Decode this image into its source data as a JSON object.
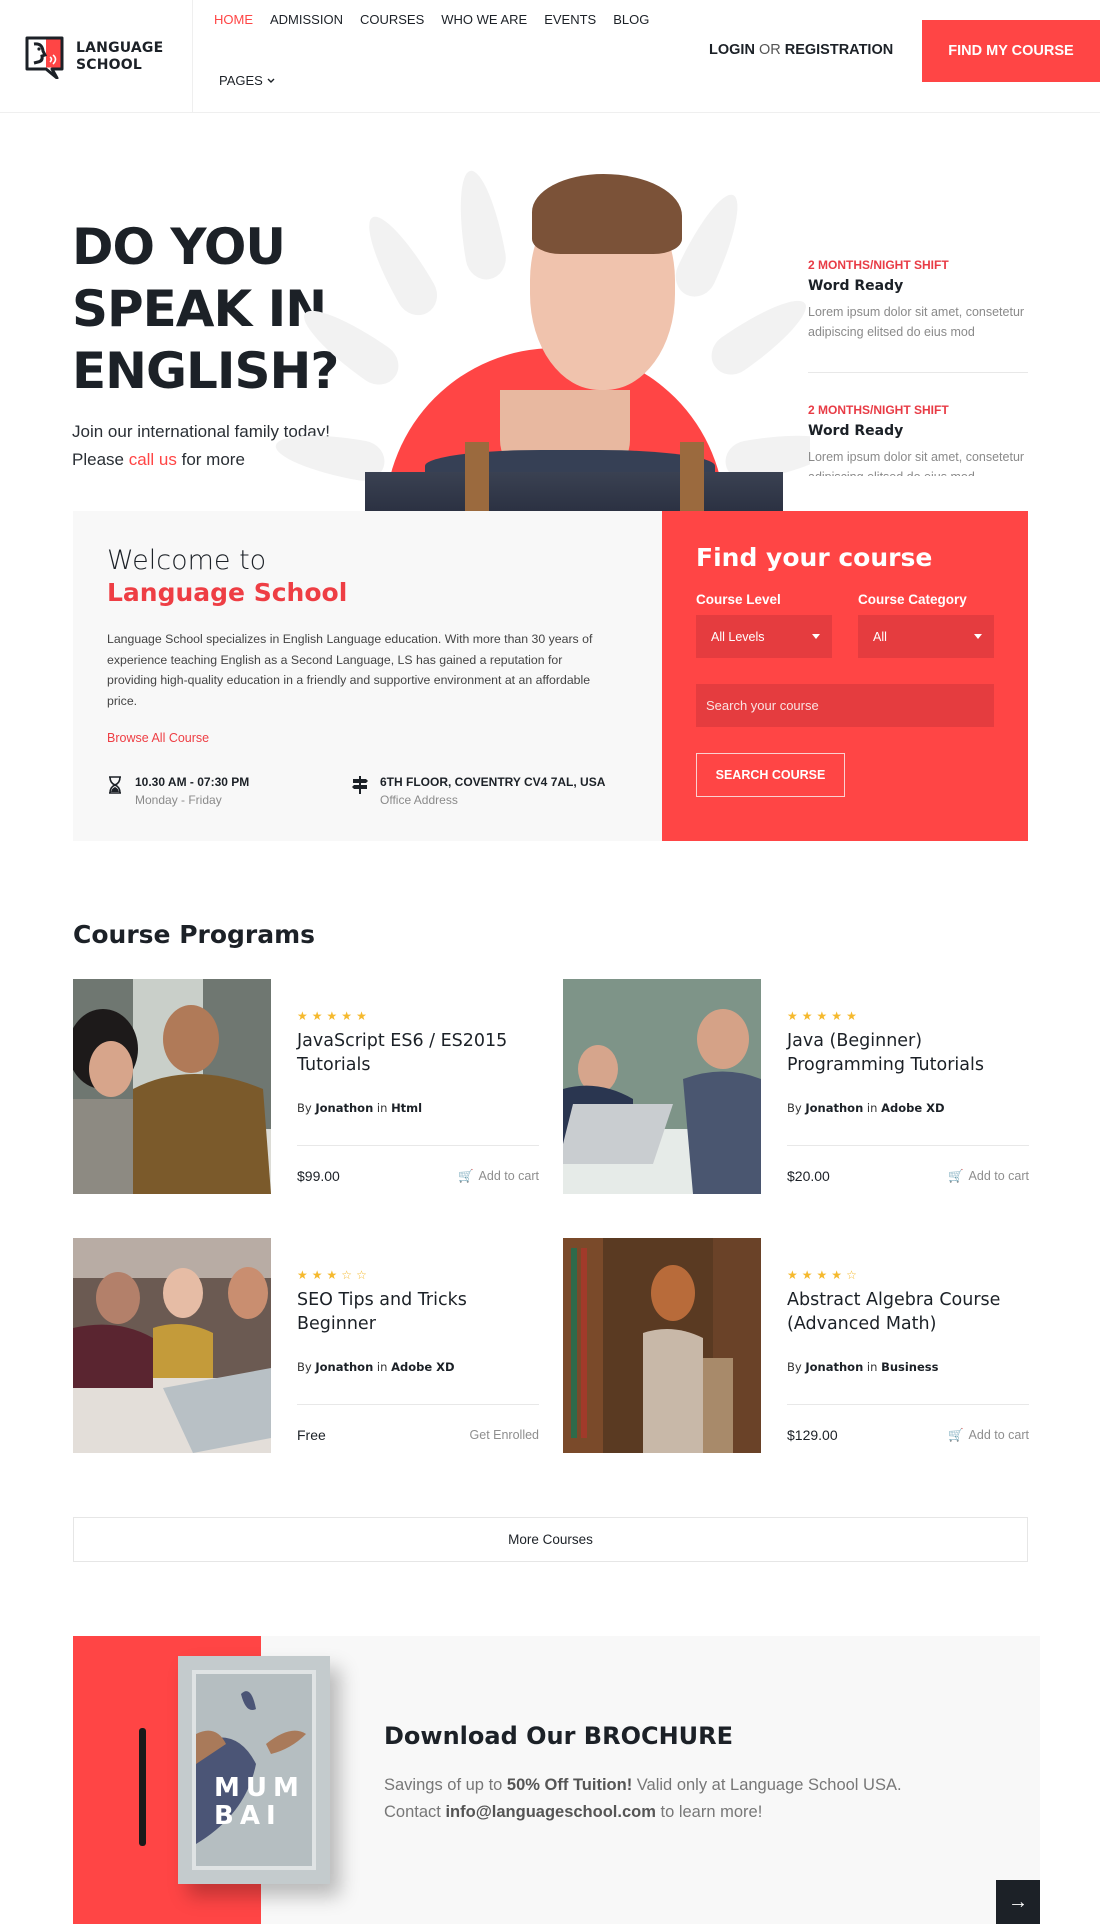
{
  "brand": {
    "line1": "LANGUAGE",
    "line2": "SCHOOL",
    "accent": "#ff4545"
  },
  "nav": {
    "items": [
      {
        "label": "HOME",
        "active": true
      },
      {
        "label": "ADMISSION"
      },
      {
        "label": "COURSES"
      },
      {
        "label": "WHO WE ARE"
      },
      {
        "label": "EVENTS"
      },
      {
        "label": "BLOG"
      }
    ],
    "pages": "PAGES",
    "login": "LOGIN",
    "or": "OR",
    "registration": "REGISTRATION",
    "cta": "FIND MY COURSE"
  },
  "hero": {
    "title_l1": "DO YOU",
    "title_l2": "SPEAK IN",
    "title_l3": "ENGLISH?",
    "sub_before": "Join our international family today! Please ",
    "sub_link": "call us",
    "sub_after": " for more",
    "shifts": [
      {
        "tag": "2 MONTHS/NIGHT SHIFT",
        "title": "Word Ready",
        "text": "Lorem ipsum dolor sit amet, consetetur adipiscing elitsed do eius mod"
      },
      {
        "tag": "2 MONTHS/NIGHT SHIFT",
        "title": "Word Ready",
        "text": "Lorem ipsum dolor sit amet, consetetur adipiscing elitsed do eius mod"
      }
    ]
  },
  "welcome": {
    "h1": "Welcome to",
    "h2": "Language School",
    "text": "Language School specializes in English Language education. With more than 30 years of experience teaching English as a Second Language, LS has gained a reputation for providing high-quality education in a friendly and supportive environment at an affordable price.",
    "browse": "Browse All Course",
    "hours": {
      "title": "10.30 AM - 07:30 PM",
      "sub": "Monday - Friday"
    },
    "address": {
      "title": "6TH FLOOR, COVENTRY CV4 7AL, USA",
      "sub": "Office Address"
    }
  },
  "find": {
    "title": "Find your course",
    "level_label": "Course Level",
    "level_value": "All Levels",
    "category_label": "Course Category",
    "category_value": "All",
    "search_placeholder": "Search your course",
    "button": "SEARCH COURSE"
  },
  "courses": {
    "title": "Course Programs",
    "by": "By",
    "in": "in",
    "items": [
      {
        "rating": 5,
        "title": "JavaScript ES6 / ES2015 Tutorials",
        "author": "Jonathon",
        "category": "Html",
        "price": "$99.00",
        "action": "Add to cart",
        "icon": "cart-icon"
      },
      {
        "rating": 5,
        "title": "Java (Beginner) Programming Tutorials",
        "author": "Jonathon",
        "category": "Adobe XD",
        "price": "$20.00",
        "action": "Add to cart",
        "icon": "cart-icon"
      },
      {
        "rating": 3,
        "title": "SEO Tips and Tricks Beginner",
        "author": "Jonathon",
        "category": "Adobe XD",
        "price": "Free",
        "action": "Get Enrolled",
        "icon": ""
      },
      {
        "rating": 4,
        "title": "Abstract Algebra Course (Advanced Math)",
        "author": "Jonathon",
        "category": "Business",
        "price": "$129.00",
        "action": "Add to cart",
        "icon": "cart-icon"
      }
    ],
    "more": "More Courses"
  },
  "brochure": {
    "book_title_l1": "MUM",
    "book_title_l2": "BAI",
    "title": "Download Our BROCHURE",
    "p1_before": "Savings of up to ",
    "p1_bold": "50% Off Tuition!",
    "p1_after": " Valid only at Language School USA.",
    "p2_before": "Contact ",
    "p2_bold": "info@languageschool.com",
    "p2_after": " to learn more!",
    "arrow": "→"
  }
}
